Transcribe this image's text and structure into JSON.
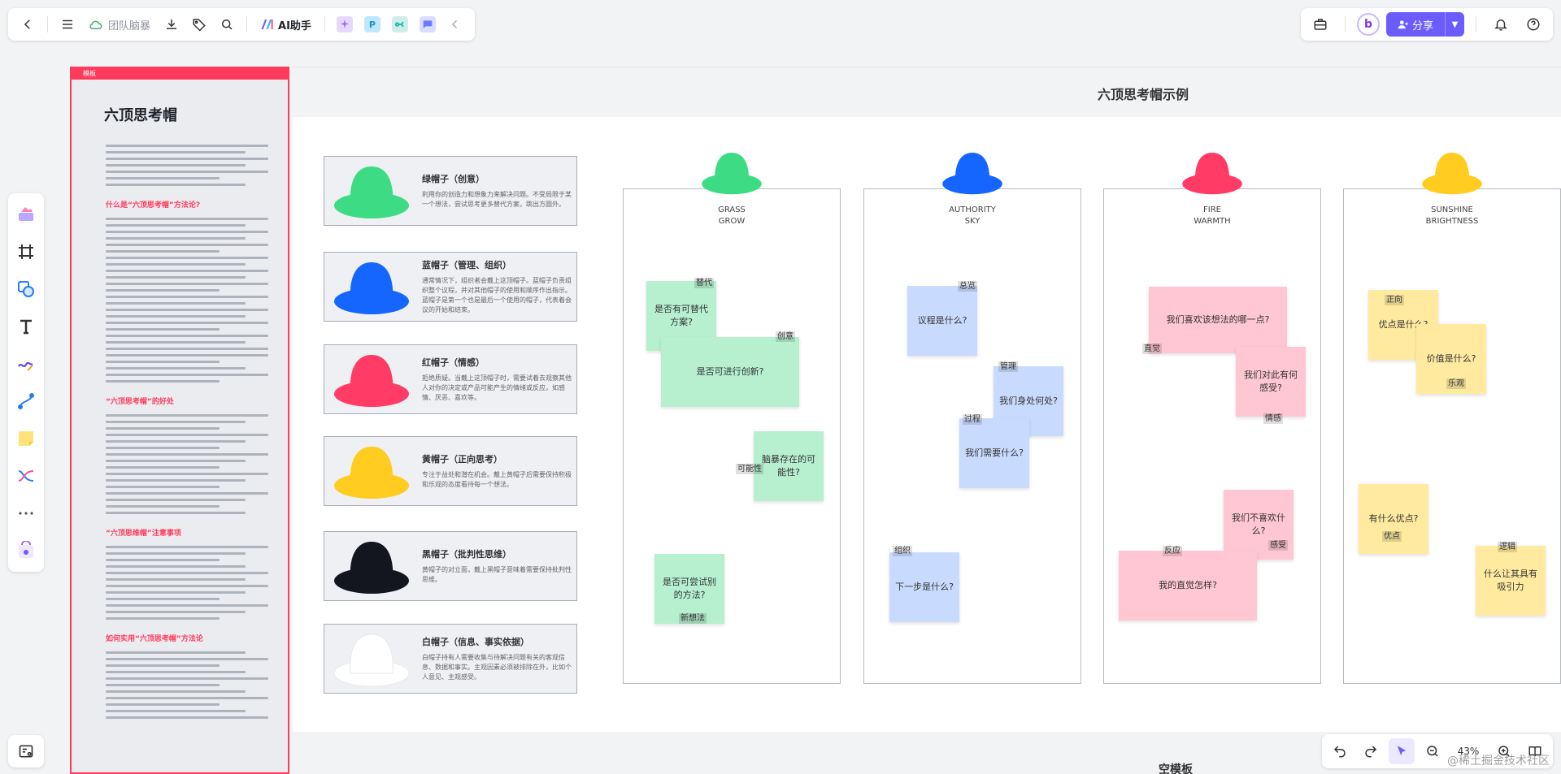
{
  "header": {
    "doc_name": "团队脑暴",
    "ai_label": "AI助手",
    "share_label": "分享",
    "avatar_letter": "b"
  },
  "doc_panel": {
    "head_label": "模板",
    "title": "六顶思考帽",
    "sections": [
      "什么是“六顶思考帽”方法论?",
      "“六顶思考帽”的好处",
      "“六顶思维帽”注意事项",
      "如何实用“六顶思考帽”方法论"
    ]
  },
  "canvas": {
    "title": "六顶思考帽示例",
    "bottom_title": "空模板"
  },
  "hat_cards": [
    {
      "title": "绿帽子（创意）",
      "desc": "利用你的创造力和想象力来解决问题。不受局限于某一个想法，尝试思考更多替代方案，跳出方圆外。",
      "color": "#3ddc84"
    },
    {
      "title": "蓝帽子（管理、组织）",
      "desc": "通常情况下，组织者会戴上这顶帽子。蓝帽子负责组织整个议程，并对其他帽子的使用和顺序作出指示。蓝帽子是第一个也是最后一个使用的帽子，代表着会议的开始和结束。",
      "color": "#1565ff"
    },
    {
      "title": "红帽子（情感）",
      "desc": "拒绝质疑。当戴上这顶帽子时，需要试着去观察其他人对你的决定或产品可能产生的情绪或反应，如感情、厌恶、喜欢等。",
      "color": "#ff3b66"
    },
    {
      "title": "黄帽子（正向思考）",
      "desc": "专注于益处和潜在机会。戴上黄帽子后需要保持积极和乐观的态度看待每一个想法。",
      "color": "#ffcc1f"
    },
    {
      "title": "黑帽子（批判性思维）",
      "desc": "黄帽子的对立面，戴上黑帽子意味着需要保持批判性思维。",
      "color": "#14161f"
    },
    {
      "title": "白帽子（信息、事实依据）",
      "desc": "白帽子持有人需要收集与待解决问题有关的客观信息、数据和事实。主观因素必须被排除在外，比如个人意见、主观感受。",
      "color": "#ffffff"
    }
  ],
  "columns": [
    {
      "line1": "GRASS",
      "line2": "GROW",
      "color": "#3ddc84"
    },
    {
      "line1": "AUTHORITY",
      "line2": "SKY",
      "color": "#1565ff"
    },
    {
      "line1": "FIRE",
      "line2": "WARMTH",
      "color": "#ff3b66"
    },
    {
      "line1": "SUNSHINE",
      "line2": "BRIGHTNESS",
      "color": "#ffcc1f"
    }
  ],
  "stickies": {
    "g1": "是否有可替代方案?",
    "g2": "是否可进行创新?",
    "g3": "脑暴存在的可能性?",
    "g4": "是否可尝试别的方法?",
    "b1": "议程是什么?",
    "b2": "我们身处何处?",
    "b3": "我们需要什么?",
    "b4": "下一步是什么?",
    "p1": "我们喜欢该想法的哪一点?",
    "p2": "我们对此有何感受?",
    "p3": "我们不喜欢什么?",
    "p4": "我的直觉怎样?",
    "y1": "优点是什么?",
    "y2": "价值是什么?",
    "y3": "有什么优点?",
    "y4": "什么让其具有吸引力"
  },
  "tags": {
    "t1": "替代",
    "t2": "创意",
    "t3": "可能性",
    "t4": "新想法",
    "t5": "总览",
    "t6": "管理",
    "t7": "过程",
    "t8": "组织",
    "t9": "直觉",
    "t10": "情感",
    "t11": "反应",
    "t12": "感受",
    "t13": "正向",
    "t14": "乐观",
    "t15": "优点",
    "t16": "逻辑"
  },
  "zoom": "43%",
  "watermark": "@稀土掘金技术社区"
}
